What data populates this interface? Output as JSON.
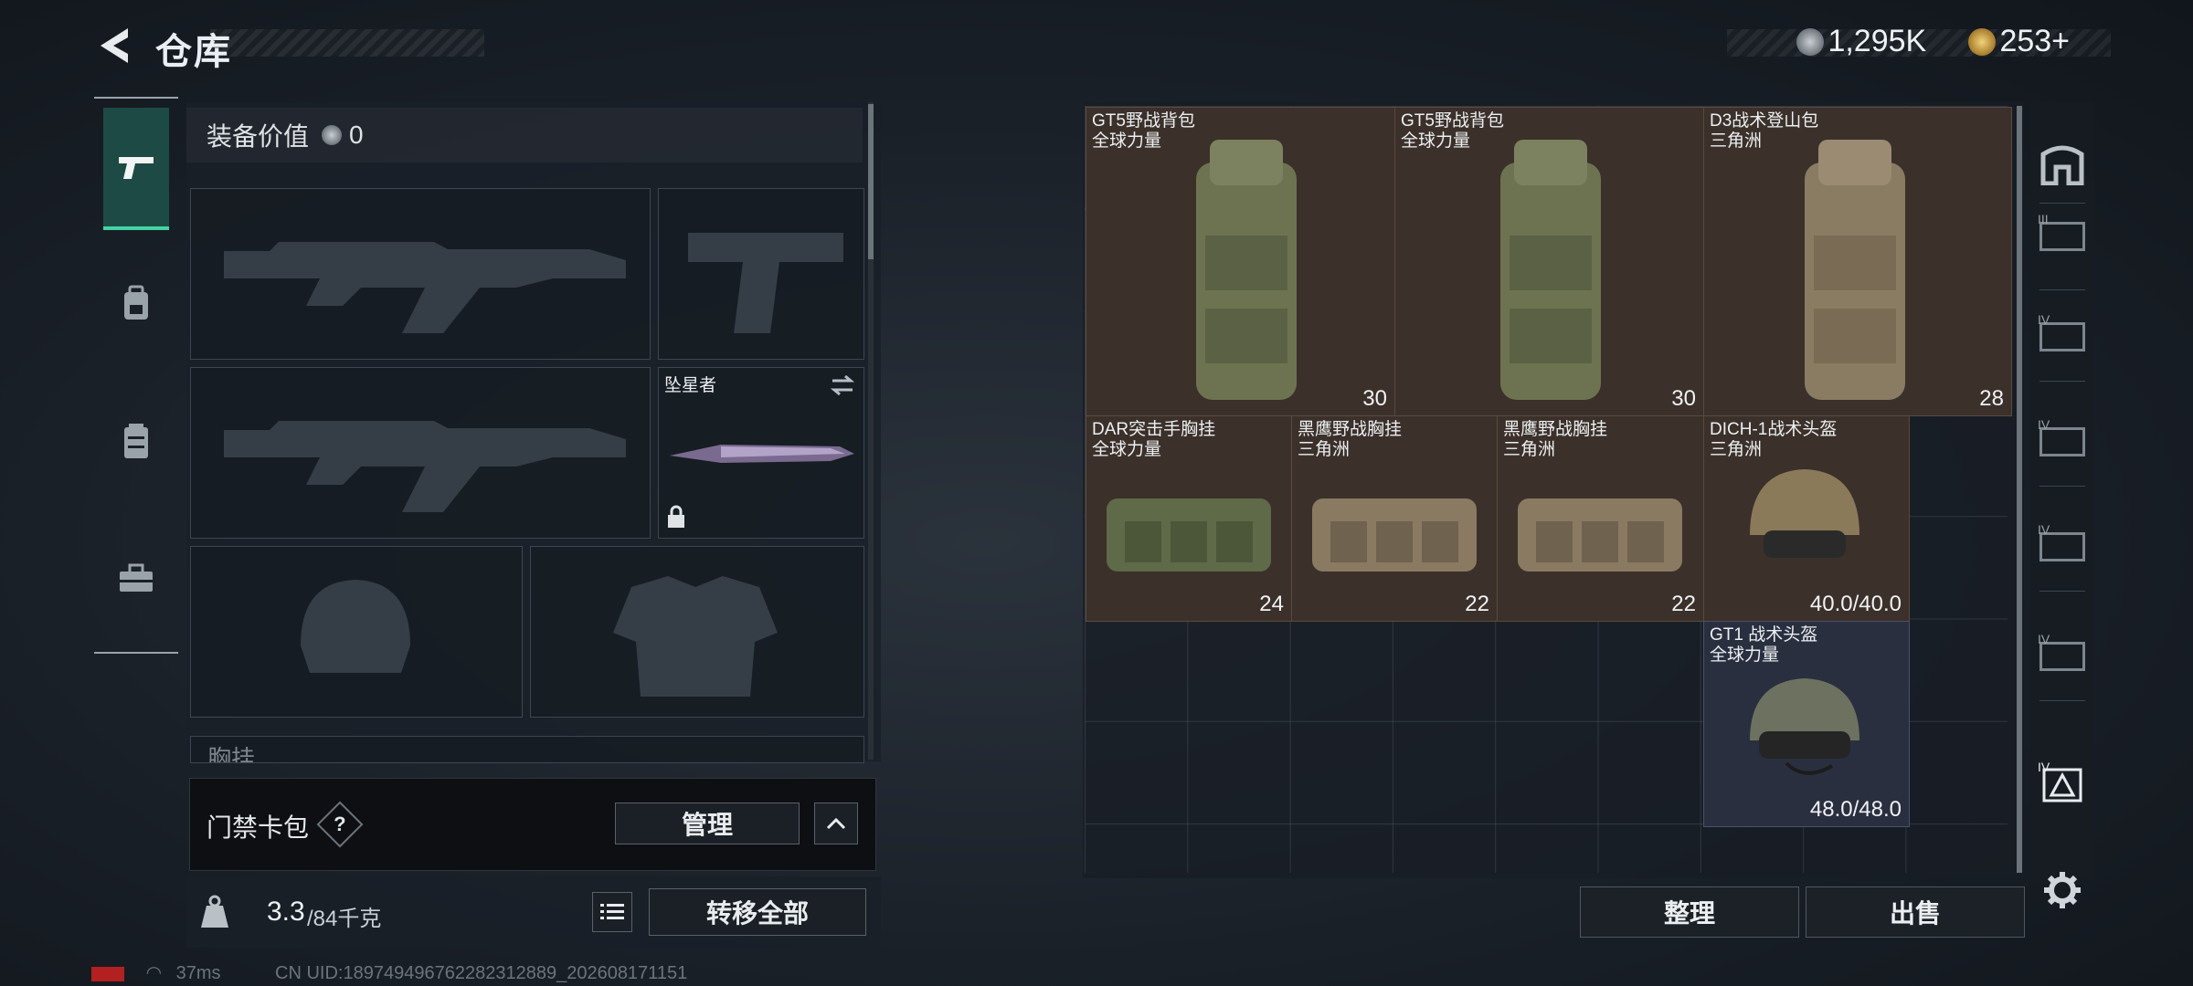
{
  "header": {
    "title": "仓库",
    "currency_1": "1,295K",
    "currency_2": "253+"
  },
  "loadout": {
    "equip_value_label": "装备价值",
    "equip_value": "0",
    "melee_name": "坠星者",
    "rig_label": "胸挂",
    "rig_badge": "?"
  },
  "card_bag": {
    "label": "门禁卡包",
    "help": "?",
    "manage_label": "管理"
  },
  "weight": {
    "current": "3.3",
    "max": "/84千克",
    "transfer_all_label": "转移全部"
  },
  "status": {
    "ping": "37ms",
    "uid": "CN UID:18974949676228231288​9_202608171151"
  },
  "stash": {
    "items": [
      {
        "name": "GT5野战背包",
        "sub": "全球力量",
        "stat": "30"
      },
      {
        "name": "GT5野战背包",
        "sub": "全球力量",
        "stat": "30"
      },
      {
        "name": "D3战术登山包",
        "sub": "三角洲",
        "stat": "28"
      },
      {
        "name": "DAR突击手胸挂",
        "sub": "全球力量",
        "stat": "24"
      },
      {
        "name": "黑鹰野战胸挂",
        "sub": "三角洲",
        "stat": "22"
      },
      {
        "name": "黑鹰野战胸挂",
        "sub": "三角洲",
        "stat": "22"
      },
      {
        "name": "DICH-1战术头盔",
        "sub": "三角洲",
        "stat": "40.0/40.0"
      },
      {
        "name": "GT1 战术头盔",
        "sub": "全球力量",
        "stat": "48.0/48.0"
      }
    ],
    "sort_label": "整理",
    "sell_label": "出售"
  },
  "category_tiers": [
    "III",
    "IV",
    "IV",
    "IV",
    "IV",
    "IV"
  ],
  "colors": {
    "accent": "#46d3a3",
    "item_bg": "#3b302a",
    "item_bg_blue": "#2a2f40"
  },
  "icons": [
    "back-arrow-icon",
    "pistol-icon",
    "backpack-icon",
    "vest-icon",
    "toolbox-icon",
    "lock-icon",
    "swap-icon",
    "list-icon",
    "chevron-up-icon",
    "gear-icon",
    "helmet-icon"
  ]
}
